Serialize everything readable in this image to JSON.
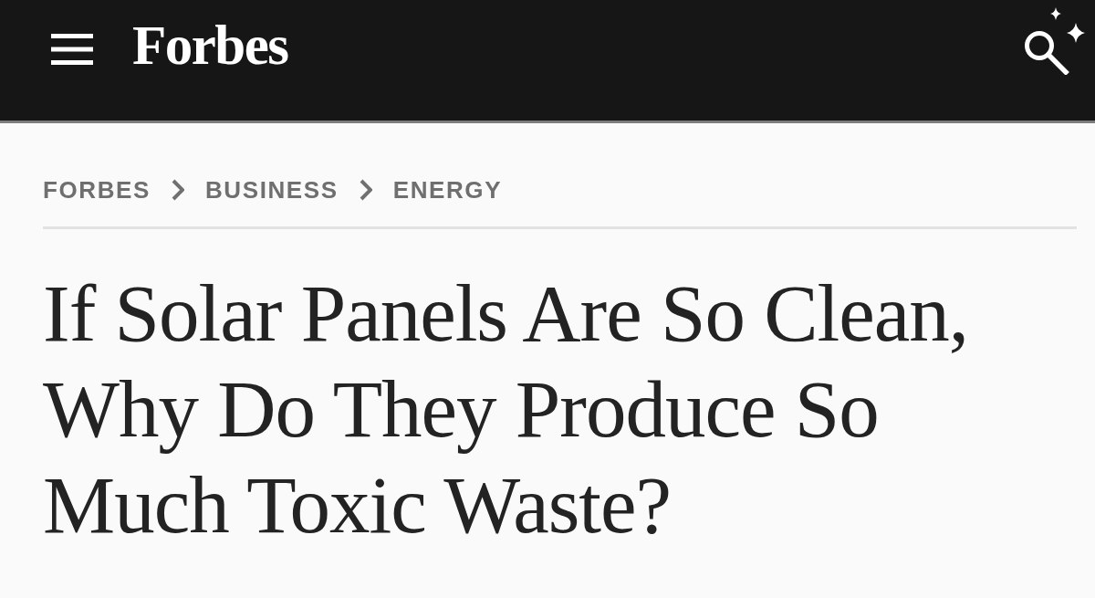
{
  "header": {
    "logo": "Forbes"
  },
  "breadcrumb": [
    {
      "label": "FORBES"
    },
    {
      "label": "BUSINESS"
    },
    {
      "label": "ENERGY"
    }
  ],
  "headline": "If Solar Panels Are So Clean, Why Do They Produce So Much Toxic Waste?"
}
